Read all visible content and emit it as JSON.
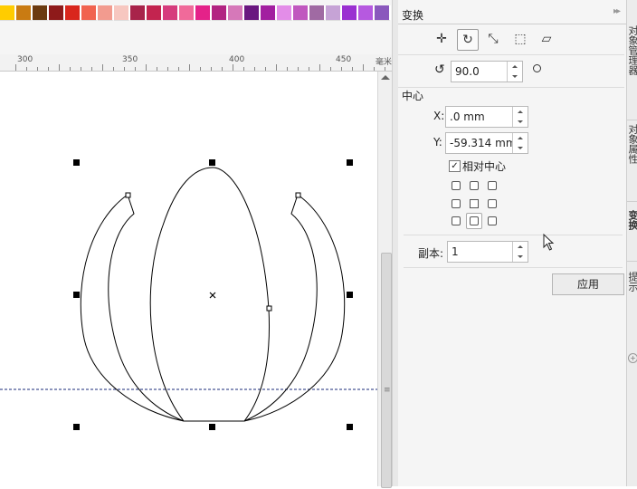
{
  "palette": {
    "colors": [
      "#ffcc00",
      "#c97b12",
      "#6b3a0f",
      "#8e1a1a",
      "#d9261c",
      "#f1634f",
      "#f29b8f",
      "#f7c7c0",
      "#a8234a",
      "#c3244f",
      "#d63c7d",
      "#f06a9a",
      "#e42289",
      "#b22382",
      "#d678b9",
      "#6a1780",
      "#a21fa0",
      "#e38de8",
      "#c057bf",
      "#a06aa3",
      "#c6a3d6",
      "#9a30d1",
      "#b659e0",
      "#8a58bd"
    ]
  },
  "ruler": {
    "labels": [
      "300",
      "350",
      "400",
      "450"
    ],
    "unit": "毫米"
  },
  "docker": {
    "title": "变换",
    "arrows": "▸▸",
    "rotation_value": "90.0",
    "center_label": "中心",
    "x_label": "X:",
    "x_value": ".0 mm",
    "y_label": "Y:",
    "y_value": "-59.314 mm",
    "relative_center_label": "相对中心",
    "relative_center_checked": "✓",
    "copies_label": "副本:",
    "copies_value": "1",
    "apply_label": "应用"
  },
  "tools": {
    "position_icon": "✛",
    "rotate_icon": "↻",
    "scale_icon": "⤡",
    "size_icon": "⬚",
    "skew_icon": "▱"
  },
  "right_tabs": {
    "tab1": "对象管理器",
    "tab2": "对象属性",
    "tab3": "变换",
    "tab4": "提示"
  }
}
